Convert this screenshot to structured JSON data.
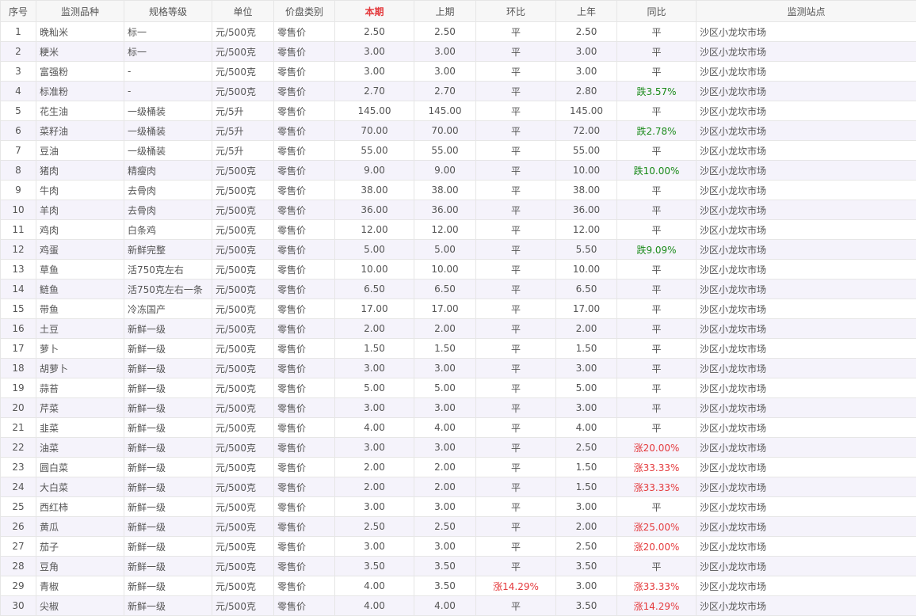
{
  "colors": {
    "up": "#e4393c",
    "down": "#1a8a1a",
    "flat": "#555555",
    "header_highlight": "#e4393c",
    "row_alt": "#f5f3fb"
  },
  "headers": {
    "index": "序号",
    "item": "监测品种",
    "spec": "规格等级",
    "unit": "单位",
    "price_type": "价盘类别",
    "current": "本期",
    "previous": "上期",
    "mom": "环比",
    "last_year": "上年",
    "yoy": "同比",
    "station": "监测站点"
  },
  "rows": [
    {
      "index": "1",
      "item": "晚籼米",
      "spec": "标一",
      "unit": "元/500克",
      "price_type": "零售价",
      "current": "2.50",
      "previous": "2.50",
      "mom": "平",
      "last_year": "2.50",
      "yoy": "平",
      "station": "沙区小龙坎市场"
    },
    {
      "index": "2",
      "item": "粳米",
      "spec": "标一",
      "unit": "元/500克",
      "price_type": "零售价",
      "current": "3.00",
      "previous": "3.00",
      "mom": "平",
      "last_year": "3.00",
      "yoy": "平",
      "station": "沙区小龙坎市场"
    },
    {
      "index": "3",
      "item": "富强粉",
      "spec": "-",
      "unit": "元/500克",
      "price_type": "零售价",
      "current": "3.00",
      "previous": "3.00",
      "mom": "平",
      "last_year": "3.00",
      "yoy": "平",
      "station": "沙区小龙坎市场"
    },
    {
      "index": "4",
      "item": "标准粉",
      "spec": "-",
      "unit": "元/500克",
      "price_type": "零售价",
      "current": "2.70",
      "previous": "2.70",
      "mom": "平",
      "last_year": "2.80",
      "yoy": "跌3.57%",
      "station": "沙区小龙坎市场"
    },
    {
      "index": "5",
      "item": "花生油",
      "spec": "一级桶装",
      "unit": "元/5升",
      "price_type": "零售价",
      "current": "145.00",
      "previous": "145.00",
      "mom": "平",
      "last_year": "145.00",
      "yoy": "平",
      "station": "沙区小龙坎市场"
    },
    {
      "index": "6",
      "item": "菜籽油",
      "spec": "一级桶装",
      "unit": "元/5升",
      "price_type": "零售价",
      "current": "70.00",
      "previous": "70.00",
      "mom": "平",
      "last_year": "72.00",
      "yoy": "跌2.78%",
      "station": "沙区小龙坎市场"
    },
    {
      "index": "7",
      "item": "豆油",
      "spec": "一级桶装",
      "unit": "元/5升",
      "price_type": "零售价",
      "current": "55.00",
      "previous": "55.00",
      "mom": "平",
      "last_year": "55.00",
      "yoy": "平",
      "station": "沙区小龙坎市场"
    },
    {
      "index": "8",
      "item": "猪肉",
      "spec": "精瘦肉",
      "unit": "元/500克",
      "price_type": "零售价",
      "current": "9.00",
      "previous": "9.00",
      "mom": "平",
      "last_year": "10.00",
      "yoy": "跌10.00%",
      "station": "沙区小龙坎市场"
    },
    {
      "index": "9",
      "item": "牛肉",
      "spec": "去骨肉",
      "unit": "元/500克",
      "price_type": "零售价",
      "current": "38.00",
      "previous": "38.00",
      "mom": "平",
      "last_year": "38.00",
      "yoy": "平",
      "station": "沙区小龙坎市场"
    },
    {
      "index": "10",
      "item": "羊肉",
      "spec": "去骨肉",
      "unit": "元/500克",
      "price_type": "零售价",
      "current": "36.00",
      "previous": "36.00",
      "mom": "平",
      "last_year": "36.00",
      "yoy": "平",
      "station": "沙区小龙坎市场"
    },
    {
      "index": "11",
      "item": "鸡肉",
      "spec": "白条鸡",
      "unit": "元/500克",
      "price_type": "零售价",
      "current": "12.00",
      "previous": "12.00",
      "mom": "平",
      "last_year": "12.00",
      "yoy": "平",
      "station": "沙区小龙坎市场"
    },
    {
      "index": "12",
      "item": "鸡蛋",
      "spec": "新鲜完整",
      "unit": "元/500克",
      "price_type": "零售价",
      "current": "5.00",
      "previous": "5.00",
      "mom": "平",
      "last_year": "5.50",
      "yoy": "跌9.09%",
      "station": "沙区小龙坎市场"
    },
    {
      "index": "13",
      "item": "草鱼",
      "spec": "活750克左右",
      "unit": "元/500克",
      "price_type": "零售价",
      "current": "10.00",
      "previous": "10.00",
      "mom": "平",
      "last_year": "10.00",
      "yoy": "平",
      "station": "沙区小龙坎市场"
    },
    {
      "index": "14",
      "item": "鲢鱼",
      "spec": "活750克左右一条",
      "unit": "元/500克",
      "price_type": "零售价",
      "current": "6.50",
      "previous": "6.50",
      "mom": "平",
      "last_year": "6.50",
      "yoy": "平",
      "station": "沙区小龙坎市场"
    },
    {
      "index": "15",
      "item": "带鱼",
      "spec": "冷冻国产",
      "unit": "元/500克",
      "price_type": "零售价",
      "current": "17.00",
      "previous": "17.00",
      "mom": "平",
      "last_year": "17.00",
      "yoy": "平",
      "station": "沙区小龙坎市场"
    },
    {
      "index": "16",
      "item": "土豆",
      "spec": "新鲜一级",
      "unit": "元/500克",
      "price_type": "零售价",
      "current": "2.00",
      "previous": "2.00",
      "mom": "平",
      "last_year": "2.00",
      "yoy": "平",
      "station": "沙区小龙坎市场"
    },
    {
      "index": "17",
      "item": "萝卜",
      "spec": "新鲜一级",
      "unit": "元/500克",
      "price_type": "零售价",
      "current": "1.50",
      "previous": "1.50",
      "mom": "平",
      "last_year": "1.50",
      "yoy": "平",
      "station": "沙区小龙坎市场"
    },
    {
      "index": "18",
      "item": "胡萝卜",
      "spec": "新鲜一级",
      "unit": "元/500克",
      "price_type": "零售价",
      "current": "3.00",
      "previous": "3.00",
      "mom": "平",
      "last_year": "3.00",
      "yoy": "平",
      "station": "沙区小龙坎市场"
    },
    {
      "index": "19",
      "item": "蒜苔",
      "spec": "新鲜一级",
      "unit": "元/500克",
      "price_type": "零售价",
      "current": "5.00",
      "previous": "5.00",
      "mom": "平",
      "last_year": "5.00",
      "yoy": "平",
      "station": "沙区小龙坎市场"
    },
    {
      "index": "20",
      "item": "芹菜",
      "spec": "新鲜一级",
      "unit": "元/500克",
      "price_type": "零售价",
      "current": "3.00",
      "previous": "3.00",
      "mom": "平",
      "last_year": "3.00",
      "yoy": "平",
      "station": "沙区小龙坎市场"
    },
    {
      "index": "21",
      "item": "韭菜",
      "spec": "新鲜一级",
      "unit": "元/500克",
      "price_type": "零售价",
      "current": "4.00",
      "previous": "4.00",
      "mom": "平",
      "last_year": "4.00",
      "yoy": "平",
      "station": "沙区小龙坎市场"
    },
    {
      "index": "22",
      "item": "油菜",
      "spec": "新鲜一级",
      "unit": "元/500克",
      "price_type": "零售价",
      "current": "3.00",
      "previous": "3.00",
      "mom": "平",
      "last_year": "2.50",
      "yoy": "涨20.00%",
      "station": "沙区小龙坎市场"
    },
    {
      "index": "23",
      "item": "圆白菜",
      "spec": "新鲜一级",
      "unit": "元/500克",
      "price_type": "零售价",
      "current": "2.00",
      "previous": "2.00",
      "mom": "平",
      "last_year": "1.50",
      "yoy": "涨33.33%",
      "station": "沙区小龙坎市场"
    },
    {
      "index": "24",
      "item": "大白菜",
      "spec": "新鲜一级",
      "unit": "元/500克",
      "price_type": "零售价",
      "current": "2.00",
      "previous": "2.00",
      "mom": "平",
      "last_year": "1.50",
      "yoy": "涨33.33%",
      "station": "沙区小龙坎市场"
    },
    {
      "index": "25",
      "item": "西红柿",
      "spec": "新鲜一级",
      "unit": "元/500克",
      "price_type": "零售价",
      "current": "3.00",
      "previous": "3.00",
      "mom": "平",
      "last_year": "3.00",
      "yoy": "平",
      "station": "沙区小龙坎市场"
    },
    {
      "index": "26",
      "item": "黄瓜",
      "spec": "新鲜一级",
      "unit": "元/500克",
      "price_type": "零售价",
      "current": "2.50",
      "previous": "2.50",
      "mom": "平",
      "last_year": "2.00",
      "yoy": "涨25.00%",
      "station": "沙区小龙坎市场"
    },
    {
      "index": "27",
      "item": "茄子",
      "spec": "新鲜一级",
      "unit": "元/500克",
      "price_type": "零售价",
      "current": "3.00",
      "previous": "3.00",
      "mom": "平",
      "last_year": "2.50",
      "yoy": "涨20.00%",
      "station": "沙区小龙坎市场"
    },
    {
      "index": "28",
      "item": "豆角",
      "spec": "新鲜一级",
      "unit": "元/500克",
      "price_type": "零售价",
      "current": "3.50",
      "previous": "3.50",
      "mom": "平",
      "last_year": "3.50",
      "yoy": "平",
      "station": "沙区小龙坎市场"
    },
    {
      "index": "29",
      "item": "青椒",
      "spec": "新鲜一级",
      "unit": "元/500克",
      "price_type": "零售价",
      "current": "4.00",
      "previous": "3.50",
      "mom": "涨14.29%",
      "last_year": "3.00",
      "yoy": "涨33.33%",
      "station": "沙区小龙坎市场"
    },
    {
      "index": "30",
      "item": "尖椒",
      "spec": "新鲜一级",
      "unit": "元/500克",
      "price_type": "零售价",
      "current": "4.00",
      "previous": "4.00",
      "mom": "平",
      "last_year": "3.50",
      "yoy": "涨14.29%",
      "station": "沙区小龙坎市场"
    }
  ]
}
